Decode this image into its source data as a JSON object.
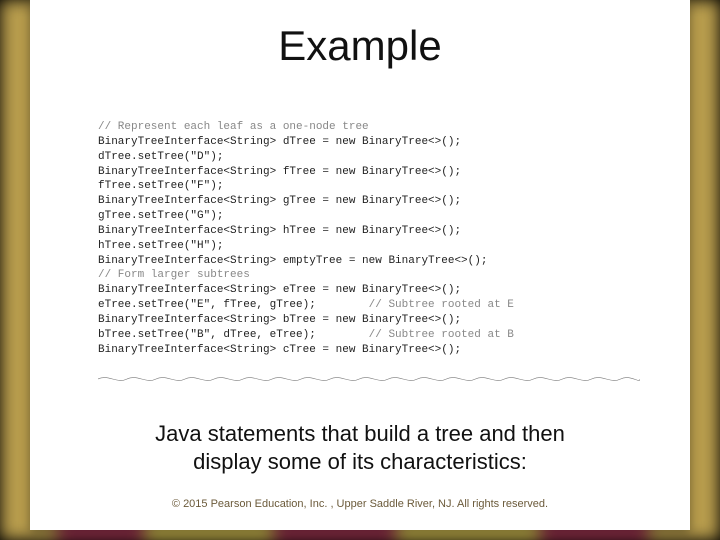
{
  "title": "Example",
  "code": {
    "comment1": "// Represent each leaf as a one-node tree",
    "l01": "BinaryTreeInterface<String> dTree = new BinaryTree<>();",
    "l02": "dTree.setTree(\"D\");",
    "l03": "BinaryTreeInterface<String> fTree = new BinaryTree<>();",
    "l04": "fTree.setTree(\"F\");",
    "l05": "BinaryTreeInterface<String> gTree = new BinaryTree<>();",
    "l06": "gTree.setTree(\"G\");",
    "l07": "BinaryTreeInterface<String> hTree = new BinaryTree<>();",
    "l08": "hTree.setTree(\"H\");",
    "l09": "BinaryTreeInterface<String> emptyTree = new BinaryTree<>();",
    "comment2": "// Form larger subtrees",
    "l10": "BinaryTreeInterface<String> eTree = new BinaryTree<>();",
    "l11a": "eTree.setTree(\"E\", fTree, gTree);",
    "l11b": "        // Subtree rooted at E",
    "l12": "BinaryTreeInterface<String> bTree = new BinaryTree<>();",
    "l13a": "bTree.setTree(\"B\", dTree, eTree);",
    "l13b": "        // Subtree rooted at B",
    "l14": "BinaryTreeInterface<String> cTree = new BinaryTree<>();"
  },
  "caption_line1": "Java statements that build a tree and then",
  "caption_line2": "display some of its characteristics:",
  "copyright": "© 2015 Pearson Education, Inc. , Upper Saddle River, NJ.  All rights reserved."
}
